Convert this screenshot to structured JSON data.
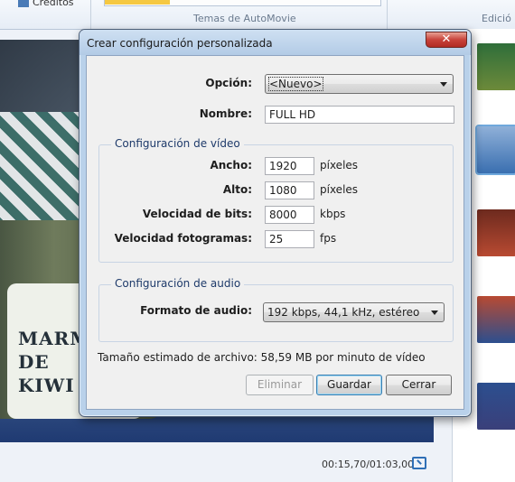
{
  "app": {
    "ribbon": {
      "credits_label": "Créditos",
      "themes_group_label": "Temas de AutoMovie",
      "edit_group_label": "Edició"
    },
    "preview": {
      "jar_label": "MARMELA\nDE\nKIWI"
    },
    "timecode": "00:15,70/01:03,00",
    "storyboard": {
      "thumbs": [
        {
          "color": "#2f6e3a"
        },
        {
          "color": "#3a6fb0",
          "selected": true
        },
        {
          "color": "#8a3a2a"
        },
        {
          "color": "#b84a32"
        },
        {
          "color": "#2c4f8f"
        },
        {
          "color": "#3a3f7a"
        }
      ]
    }
  },
  "dialog": {
    "title": "Crear configuración personalizada",
    "close_symbol": "✕",
    "option": {
      "label": "Opción:",
      "value": "<Nuevo>"
    },
    "name": {
      "label": "Nombre:",
      "value": "FULL HD"
    },
    "video_group": {
      "title": "Configuración de vídeo",
      "width": {
        "label": "Ancho:",
        "value": "1920",
        "unit": "píxeles"
      },
      "height": {
        "label": "Alto:",
        "value": "1080",
        "unit": "píxeles"
      },
      "bitrate": {
        "label": "Velocidad de bits:",
        "value": "8000",
        "unit": "kbps"
      },
      "framerate": {
        "label": "Velocidad fotogramas:",
        "value": "25",
        "unit": "fps"
      }
    },
    "audio_group": {
      "title": "Configuración de audio",
      "format": {
        "label": "Formato de audio:",
        "value": "192 kbps, 44,1 kHz, estéreo"
      }
    },
    "estimate": "Tamaño estimado de archivo: 58,59 MB por minuto de vídeo",
    "buttons": {
      "delete": "Eliminar",
      "save": "Guardar",
      "close": "Cerrar"
    }
  }
}
